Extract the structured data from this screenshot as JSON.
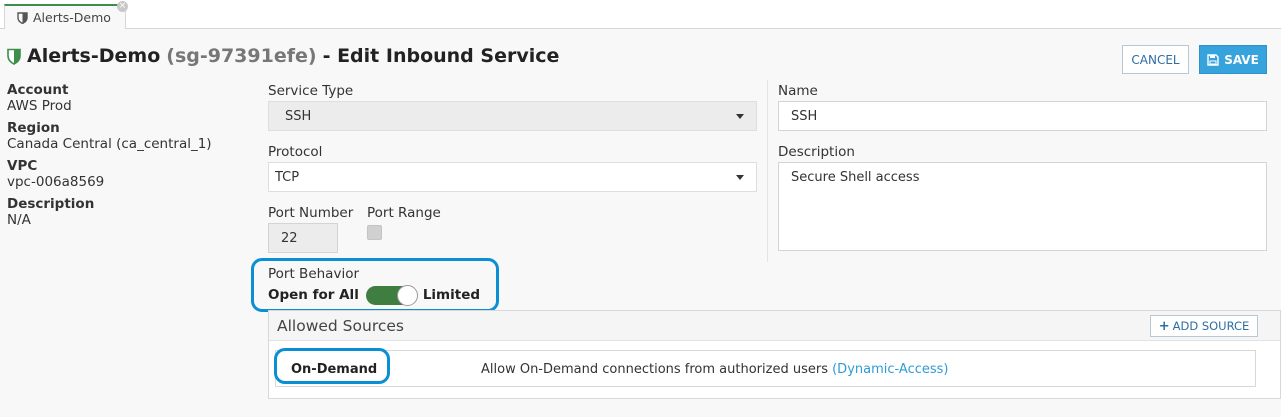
{
  "tab": {
    "label": "Alerts-Demo",
    "close": "×"
  },
  "header": {
    "name": "Alerts-Demo",
    "sg_id": "(sg-97391efe)",
    "suffix": "- Edit Inbound Service",
    "cancel_label": "CANCEL",
    "save_label": "SAVE"
  },
  "meta": {
    "account_label": "Account",
    "account_value": "AWS Prod",
    "region_label": "Region",
    "region_value": "Canada Central (ca_central_1)",
    "vpc_label": "VPC",
    "vpc_value": "vpc-006a8569",
    "description_label": "Description",
    "description_value": "N/A"
  },
  "form": {
    "service_type_label": "Service Type",
    "service_type_value": "SSH",
    "protocol_label": "Protocol",
    "protocol_value": "TCP",
    "port_number_label": "Port Number",
    "port_number_value": "22",
    "port_range_label": "Port Range",
    "name_label": "Name",
    "name_value": "SSH",
    "description_label": "Description",
    "description_value": "Secure Shell access",
    "port_behavior_label": "Port Behavior",
    "toggle_left_label": "Open for All",
    "toggle_right_label": "Limited"
  },
  "sources": {
    "title": "Allowed Sources",
    "add_label": "ADD SOURCE",
    "rows": [
      {
        "name": "On-Demand",
        "description": "Allow On-Demand connections from authorized users",
        "link": "(Dynamic-Access)"
      }
    ]
  },
  "colors": {
    "accent": "#36a3dc",
    "toggle": "#3f7d40",
    "highlight": "#0a8fd4",
    "link": "#2f9bd6"
  }
}
